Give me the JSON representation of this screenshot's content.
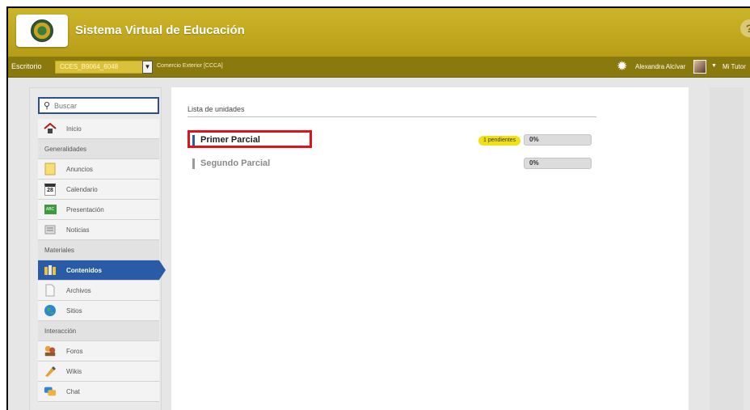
{
  "header": {
    "app_title": "Sistema Virtual de Educación",
    "help": "?"
  },
  "toolbar": {
    "desk_label": "Escritorio",
    "course_code": "CCES_B9064_6048",
    "course_caret": "▼",
    "course_name": "Comercio Exterior [CCCA]",
    "user_name": "Alexandra Alcívar",
    "avatar_caret": "▼",
    "tutor_label": "Mi Tutor"
  },
  "sidebar": {
    "search_placeholder": "Buscar",
    "items": [
      {
        "type": "item",
        "label": "Inicio",
        "icon": "home-icon"
      },
      {
        "type": "section",
        "label": "Generalidades"
      },
      {
        "type": "item",
        "label": "Anuncios",
        "icon": "announcement-icon"
      },
      {
        "type": "item",
        "label": "Calendario",
        "icon": "calendar-icon",
        "glyph": "28"
      },
      {
        "type": "item",
        "label": "Presentación",
        "icon": "presentation-icon",
        "glyph": "ABC"
      },
      {
        "type": "item",
        "label": "Noticias",
        "icon": "news-icon"
      },
      {
        "type": "section",
        "label": "Materiales"
      },
      {
        "type": "item",
        "label": "Contenidos",
        "icon": "contents-icon",
        "active": true
      },
      {
        "type": "item",
        "label": "Archivos",
        "icon": "files-icon"
      },
      {
        "type": "item",
        "label": "Sitios",
        "icon": "globe-icon"
      },
      {
        "type": "section",
        "label": "Interacción"
      },
      {
        "type": "item",
        "label": "Foros",
        "icon": "forum-icon"
      },
      {
        "type": "item",
        "label": "Wikis",
        "icon": "wiki-icon"
      },
      {
        "type": "item",
        "label": "Chat",
        "icon": "chat-icon"
      }
    ]
  },
  "main": {
    "section_title": "Lista de unidades",
    "units": [
      {
        "name": "Primer Parcial",
        "pending": "1 pendientes",
        "progress": "0%",
        "progress_value": 0,
        "bar_color": "#2a5ba7",
        "name_color": "#222222",
        "highlighted": true
      },
      {
        "name": "Segundo Parcial",
        "pending": "",
        "progress": "0%",
        "progress_value": 0,
        "bar_color": "#9a9a9a",
        "name_color": "#8a8a8a",
        "highlighted": false
      }
    ]
  },
  "colors": {
    "header": "#c4ab22",
    "toolbar": "#8a7a0e",
    "active": "#2a5ba7",
    "highlight": "#e3111a",
    "badge": "#f2e014"
  }
}
